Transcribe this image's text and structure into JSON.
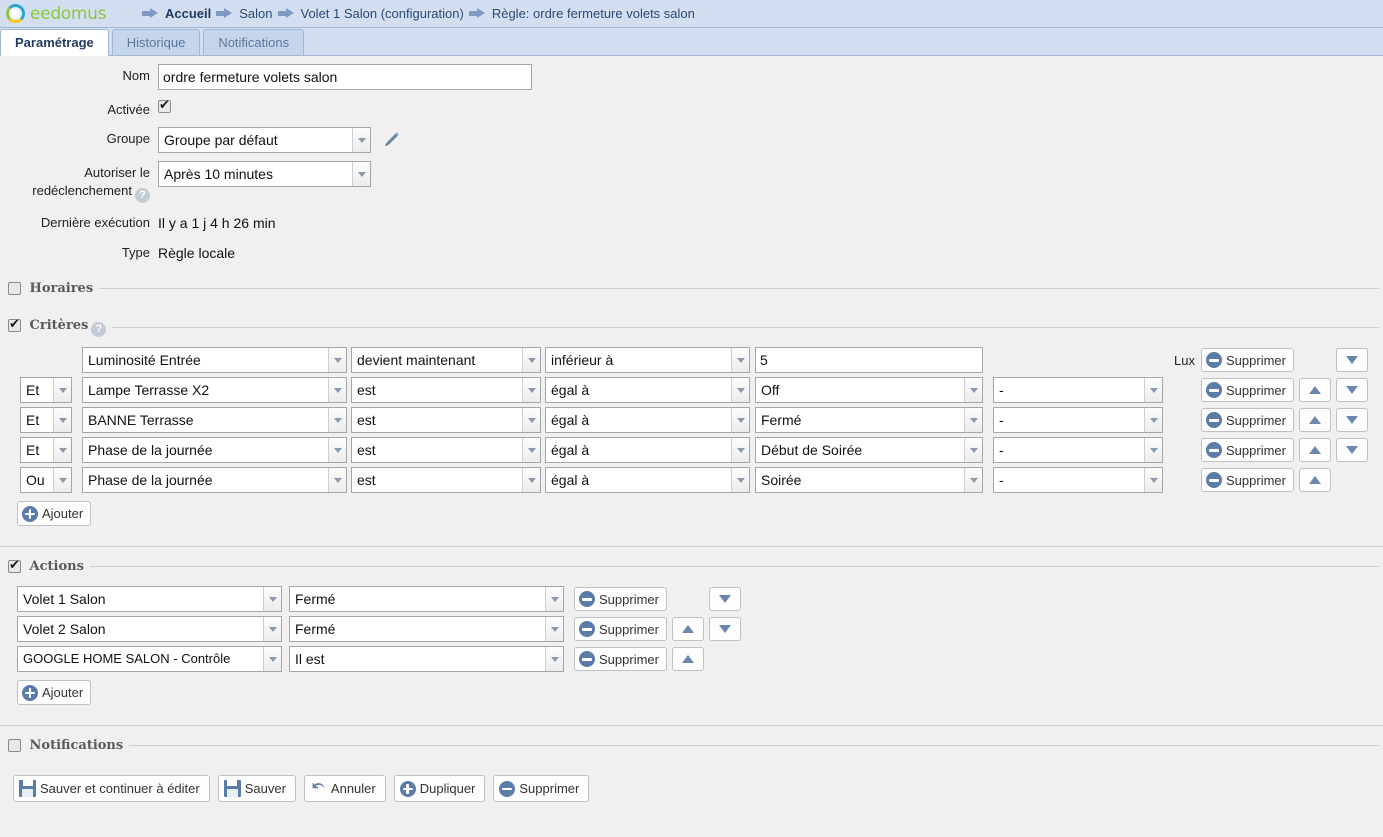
{
  "brand": {
    "name": "eedomus",
    "logo_icon": "eedomus-ring-logo"
  },
  "breadcrumb": {
    "arrow_icon": "arrow-right-icon",
    "items": [
      {
        "label": "Accueil",
        "active": true
      },
      {
        "label": "Salon",
        "active": false
      },
      {
        "label": "Volet 1 Salon (configuration)",
        "active": false
      },
      {
        "label": "Règle: ordre fermeture volets salon",
        "active": false
      }
    ]
  },
  "tabs": [
    {
      "label": "Paramétrage",
      "active": true
    },
    {
      "label": "Historique",
      "active": false
    },
    {
      "label": "Notifications",
      "active": false
    }
  ],
  "form": {
    "nom": {
      "label": "Nom",
      "value": "ordre fermeture volets salon"
    },
    "activee": {
      "label": "Activée",
      "checked": true
    },
    "groupe": {
      "label": "Groupe",
      "value": "Groupe par défaut",
      "edit_icon": "pencil-icon"
    },
    "redeclenchement": {
      "label_line1": "Autoriser le",
      "label_line2": "redéclenchement",
      "help_icon": "help-icon",
      "help_glyph": "?",
      "value": "Après 10 minutes"
    },
    "derniere_execution": {
      "label": "Dernière exécution",
      "value": "Il y a 1 j 4 h 26 min"
    },
    "type": {
      "label": "Type",
      "value": "Règle locale"
    }
  },
  "sections": {
    "horaires": {
      "label": "Horaires",
      "checked": false
    },
    "criteres": {
      "label": "Critères",
      "checked": true,
      "help_glyph": "?"
    },
    "actions": {
      "label": "Actions",
      "checked": true
    },
    "notifications": {
      "label": "Notifications",
      "checked": false
    }
  },
  "criteria": {
    "add_label": "Ajouter",
    "delete_label": "Supprimer",
    "rows": [
      {
        "operator": null,
        "device": "Luminosité Entrée",
        "when": "devient maintenant",
        "comparator": "inférieur à",
        "value": "5",
        "value_is_input": true,
        "extra": null,
        "unit": "Lux",
        "can_move_up": false,
        "can_move_down": true
      },
      {
        "operator": "Et",
        "device": "Lampe Terrasse X2",
        "when": "est",
        "comparator": "égal à",
        "value": "Off",
        "value_is_input": false,
        "extra": "-",
        "unit": "",
        "can_move_up": true,
        "can_move_down": true
      },
      {
        "operator": "Et",
        "device": "BANNE Terrasse",
        "when": "est",
        "comparator": "égal à",
        "value": "Fermé",
        "value_is_input": false,
        "extra": "-",
        "unit": "",
        "can_move_up": true,
        "can_move_down": true
      },
      {
        "operator": "Et",
        "device": "Phase de la journée",
        "when": "est",
        "comparator": "égal à",
        "value": "Début de Soirée",
        "value_is_input": false,
        "extra": "-",
        "unit": "",
        "can_move_up": true,
        "can_move_down": true
      },
      {
        "operator": "Ou",
        "device": "Phase de la journée",
        "when": "est",
        "comparator": "égal à",
        "value": "Soirée",
        "value_is_input": false,
        "extra": "-",
        "unit": "",
        "can_move_up": true,
        "can_move_down": false
      }
    ]
  },
  "actions": {
    "add_label": "Ajouter",
    "delete_label": "Supprimer",
    "rows": [
      {
        "device": "Volet 1 Salon",
        "value": "Fermé",
        "can_move_up": false,
        "can_move_down": true
      },
      {
        "device": "Volet 2 Salon",
        "value": "Fermé",
        "can_move_up": true,
        "can_move_down": true
      },
      {
        "device": "GOOGLE HOME SALON - Contrôle",
        "value": "Il est",
        "can_move_up": true,
        "can_move_down": false
      }
    ]
  },
  "footer": {
    "buttons": [
      {
        "label": "Sauver et continuer à éditer",
        "icon": "save-icon"
      },
      {
        "label": "Sauver",
        "icon": "save-icon"
      },
      {
        "label": "Annuler",
        "icon": "undo-icon"
      },
      {
        "label": "Dupliquer",
        "icon": "plus-circle-icon"
      },
      {
        "label": "Supprimer",
        "icon": "minus-circle-icon"
      }
    ]
  }
}
